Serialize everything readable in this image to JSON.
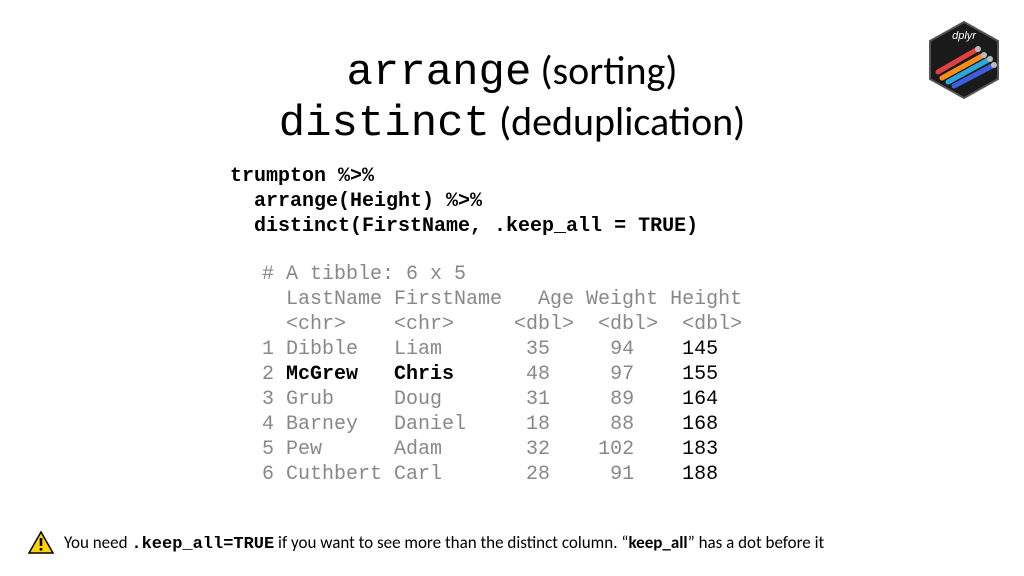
{
  "title": {
    "l1_mono": "arrange",
    "l1_sans": " (sorting)",
    "l2_mono": "distinct",
    "l2_sans": " (deduplication)"
  },
  "code": {
    "l1": "trumpton %>%",
    "l2": "  arrange(Height) %>%",
    "l3": "  distinct(FirstName, .keep_all = TRUE)"
  },
  "output": {
    "header": "# A tibble: 6 x 5",
    "cols": "  LastName FirstName   Age Weight Height",
    "types": "  <chr>    <chr>     <dbl>  <dbl>  <dbl>",
    "rows": [
      {
        "n": "1",
        "ln": "Dibble  ",
        "fn": "Liam   ",
        "age": "    35",
        "wt": "    94",
        "ht": "    145",
        "bold": false
      },
      {
        "n": "2",
        "ln": "McGrew  ",
        "fn": "Chris  ",
        "age": "    48",
        "wt": "    97",
        "ht": "    155",
        "bold": true
      },
      {
        "n": "3",
        "ln": "Grub    ",
        "fn": "Doug   ",
        "age": "    31",
        "wt": "    89",
        "ht": "    164",
        "bold": false
      },
      {
        "n": "4",
        "ln": "Barney  ",
        "fn": "Daniel ",
        "age": "    18",
        "wt": "    88",
        "ht": "    168",
        "bold": false
      },
      {
        "n": "5",
        "ln": "Pew     ",
        "fn": "Adam   ",
        "age": "    32",
        "wt": "   102",
        "ht": "    183",
        "bold": false
      },
      {
        "n": "6",
        "ln": "Cuthbert",
        "fn": "Carl   ",
        "age": "    28",
        "wt": "    91",
        "ht": "    188",
        "bold": false
      }
    ]
  },
  "footer": {
    "p1": "You need ",
    "code": ".keep_all=TRUE",
    "p2": "  if you want to see more than the distinct column. “",
    "bold": "keep_all",
    "p3": "” has a dot before it"
  },
  "logo": {
    "label": "dplyr"
  },
  "chart_data": {
    "type": "table",
    "title": "A tibble: 6 x 5",
    "columns": [
      "LastName",
      "FirstName",
      "Age",
      "Weight",
      "Height"
    ],
    "coltypes": [
      "chr",
      "chr",
      "dbl",
      "dbl",
      "dbl"
    ],
    "rows": [
      [
        "Dibble",
        "Liam",
        35,
        94,
        145
      ],
      [
        "McGrew",
        "Chris",
        48,
        97,
        155
      ],
      [
        "Grub",
        "Doug",
        31,
        89,
        164
      ],
      [
        "Barney",
        "Daniel",
        18,
        88,
        168
      ],
      [
        "Pew",
        "Adam",
        32,
        102,
        183
      ],
      [
        "Cuthbert",
        "Carl",
        28,
        91,
        188
      ]
    ]
  }
}
